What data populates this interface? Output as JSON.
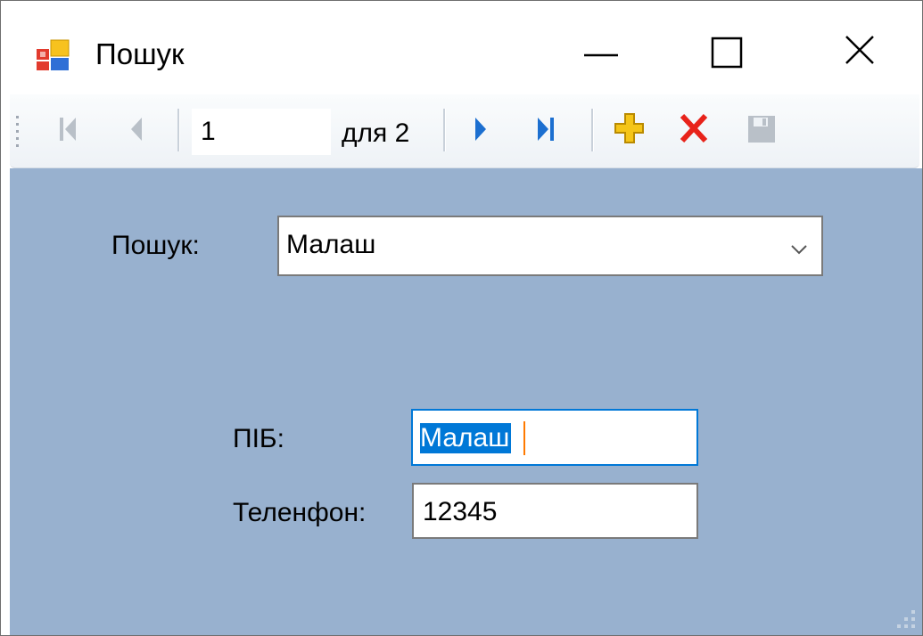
{
  "window": {
    "title": "Пошук",
    "icon": "form-app-icon"
  },
  "title_buttons": {
    "minimize": "minimize-icon",
    "maximize": "maximize-icon",
    "close": "close-icon"
  },
  "navigator": {
    "position": "1",
    "count_label": "для 2",
    "buttons": [
      "move-first-icon",
      "move-previous-icon",
      "move-next-icon",
      "move-last-icon",
      "add-new-icon",
      "delete-icon",
      "save-icon"
    ]
  },
  "search": {
    "label": "Пошук:",
    "selected": "Малаш"
  },
  "form": {
    "fio_label": "ПІБ:",
    "fio_value": "Малаш",
    "phone_label": "Теленфон:",
    "phone_value": "12345"
  },
  "colors": {
    "form_background": "#98b1cf",
    "selection": "#0078d7",
    "focus_border": "#0078d7",
    "delete_red": "#e8231a",
    "add_yellow": "#f5c518",
    "nav_blue": "#1c6fd0"
  }
}
